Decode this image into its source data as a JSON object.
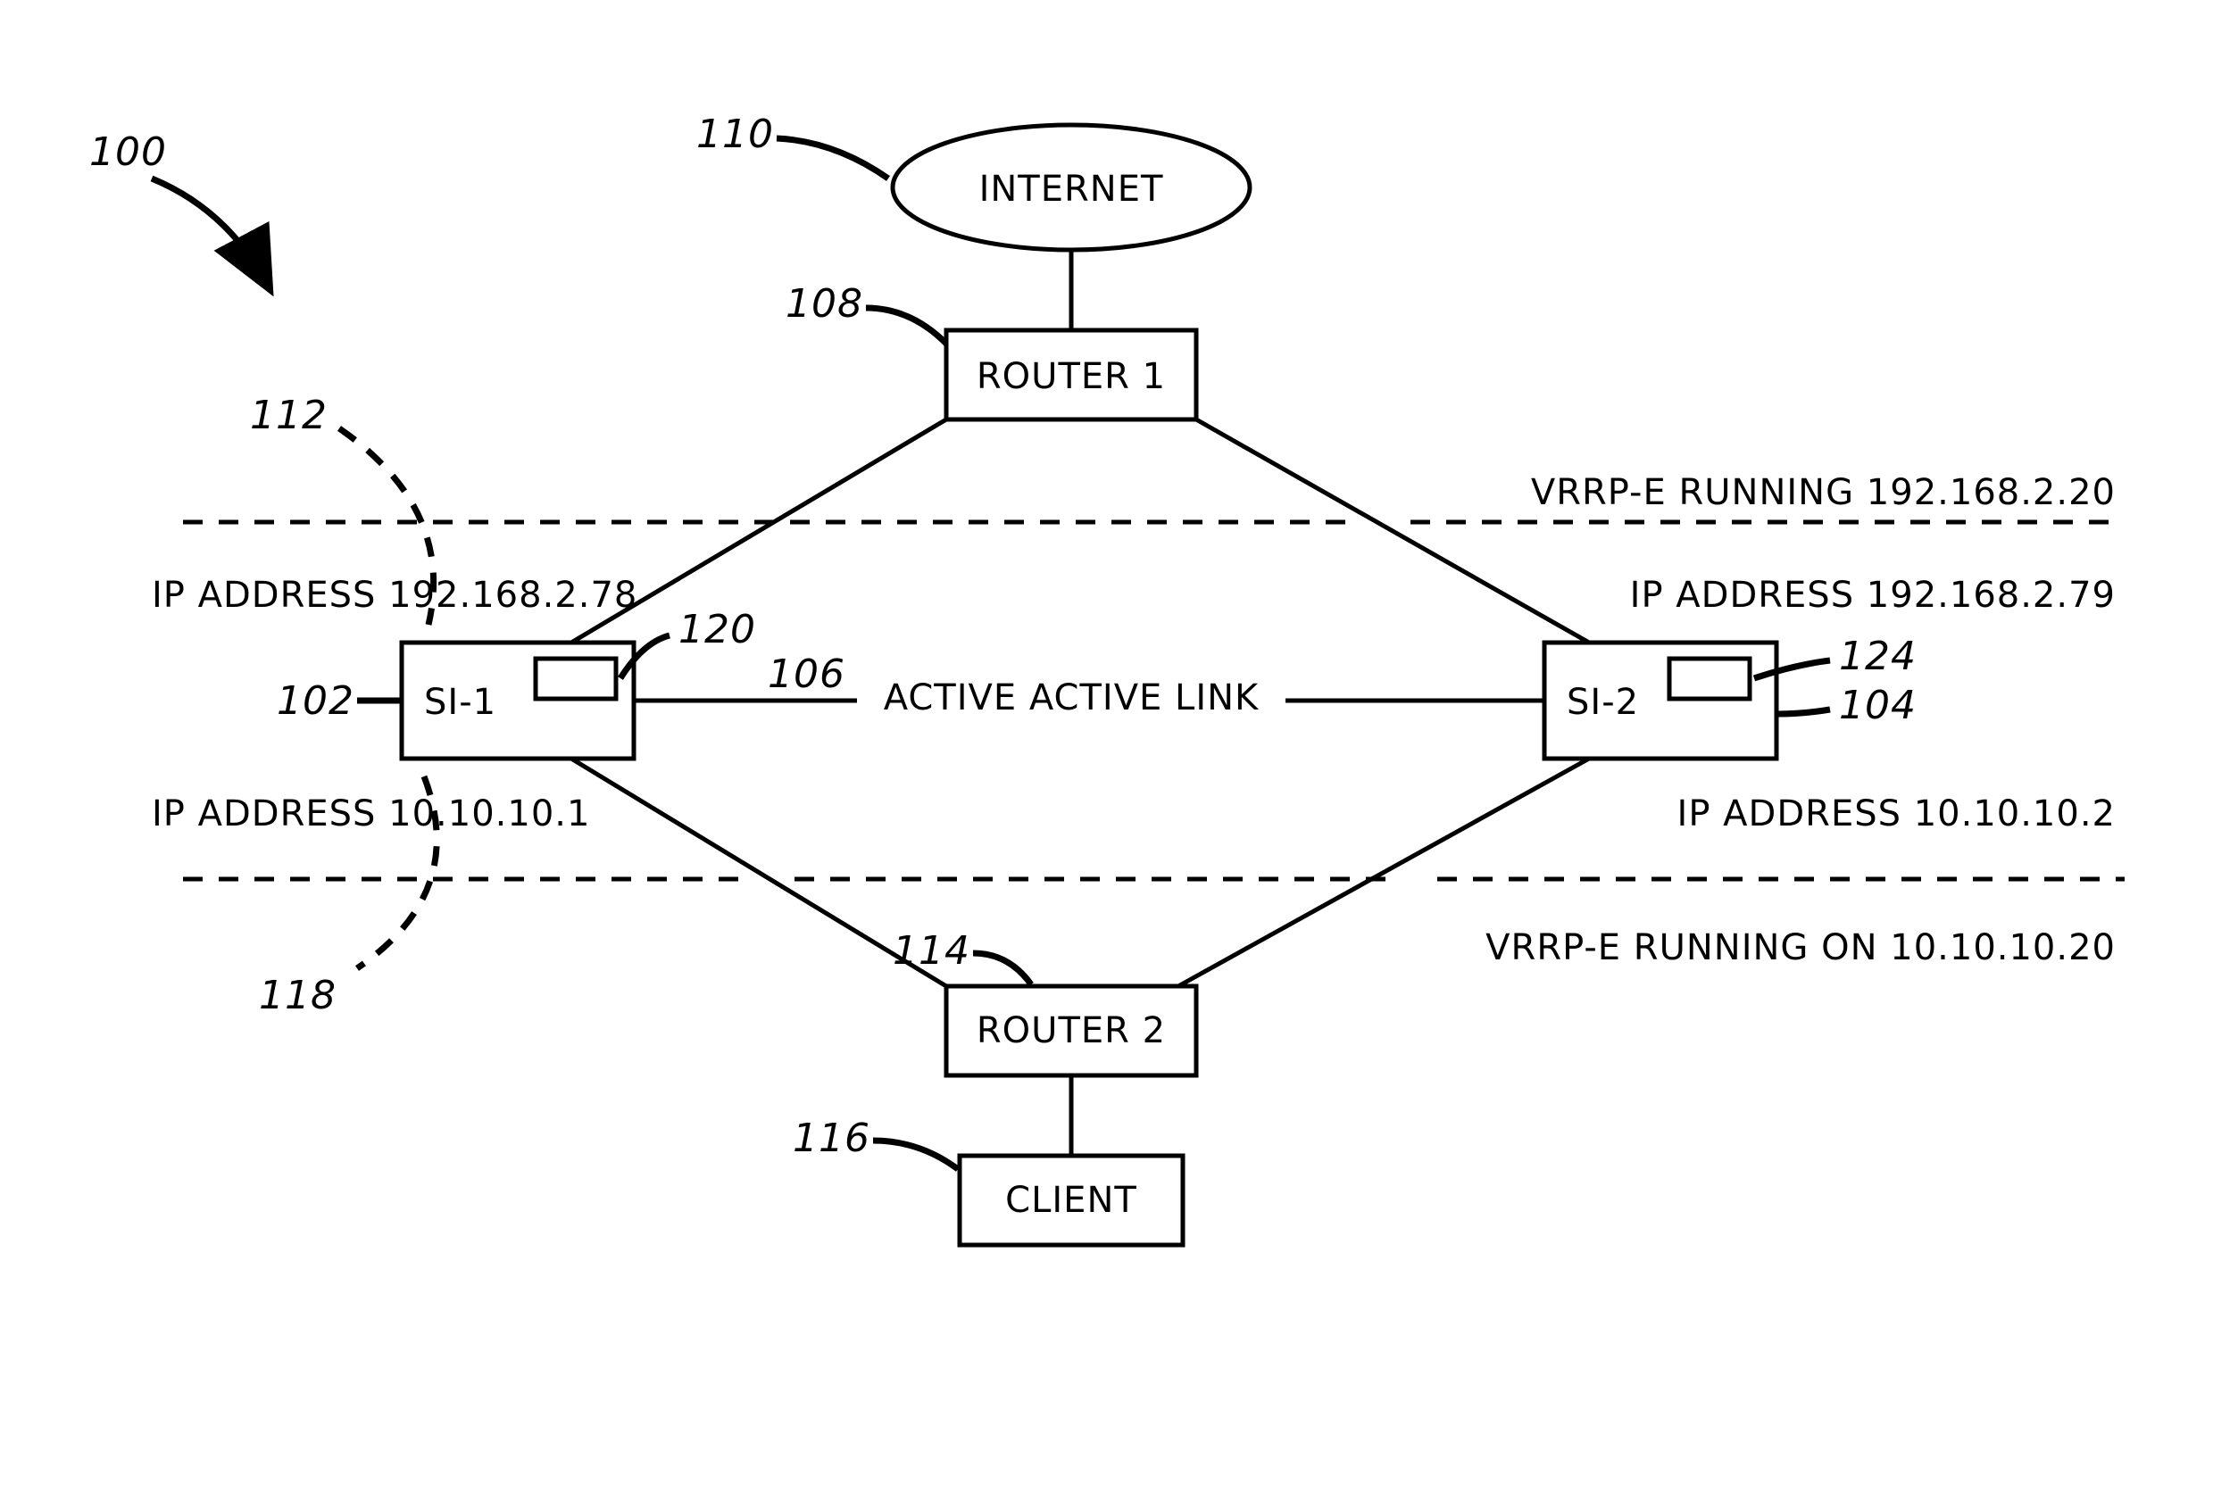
{
  "chart_data": {
    "type": "diagram",
    "title": "High-Availability Network Diagram 100",
    "nodes": [
      {
        "id": "internet",
        "ref": "110",
        "label": "INTERNET",
        "shape": "ellipse"
      },
      {
        "id": "router1",
        "ref": "108",
        "label": "ROUTER 1",
        "shape": "rect"
      },
      {
        "id": "si1",
        "ref": "102",
        "label": "SI-1",
        "shape": "rect",
        "ip_top": "IP ADDRESS 192.168.2.78",
        "ip_bottom": "IP ADDRESS 10.10.10.1",
        "inner_rect_ref": "120"
      },
      {
        "id": "si2",
        "ref": "104",
        "label": "SI-2",
        "shape": "rect",
        "ip_top": "IP ADDRESS 192.168.2.79",
        "ip_bottom": "IP ADDRESS 10.10.10.2",
        "inner_rect_ref": "124"
      },
      {
        "id": "router2",
        "ref": "114",
        "label": "ROUTER 2",
        "shape": "rect"
      },
      {
        "id": "client",
        "ref": "116",
        "label": "CLIENT",
        "shape": "rect"
      }
    ],
    "edges": [
      {
        "from": "internet",
        "to": "router1",
        "style": "solid"
      },
      {
        "from": "router1",
        "to": "si1",
        "style": "solid"
      },
      {
        "from": "router1",
        "to": "si2",
        "style": "solid"
      },
      {
        "from": "si1",
        "to": "si2",
        "style": "solid",
        "label": "ACTIVE ACTIVE LINK",
        "ref": "106"
      },
      {
        "from": "si1",
        "to": "router2",
        "style": "solid"
      },
      {
        "from": "si2",
        "to": "router2",
        "style": "solid"
      },
      {
        "from": "router2",
        "to": "client",
        "style": "solid"
      }
    ],
    "regions": [
      {
        "ref": "112",
        "label": "VRRP-E RUNNING 192.168.2.20",
        "position": "upper"
      },
      {
        "ref": "118",
        "label": "VRRP-E RUNNING ON 10.10.10.20",
        "position": "lower"
      }
    ],
    "figure_ref": "100"
  },
  "labels": {
    "fig_ref": "100",
    "internet": "INTERNET",
    "internet_ref": "110",
    "router1": "ROUTER 1",
    "router1_ref": "108",
    "si1": "SI-1",
    "si1_ref": "102",
    "si1_inner_ref": "120",
    "si1_ip_top": "IP ADDRESS 192.168.2.78",
    "si1_ip_bottom": "IP ADDRESS 10.10.10.1",
    "si2": "SI-2",
    "si2_ref": "104",
    "si2_inner_ref": "124",
    "si2_ip_top": "IP ADDRESS 192.168.2.79",
    "si2_ip_bottom": "IP ADDRESS 10.10.10.2",
    "router2": "ROUTER 2",
    "router2_ref": "114",
    "client": "CLIENT",
    "client_ref": "116",
    "link_label": "ACTIVE ACTIVE LINK",
    "link_ref": "106",
    "upper_region_ref": "112",
    "upper_region_label": "VRRP-E RUNNING 192.168.2.20",
    "lower_region_ref": "118",
    "lower_region_label": "VRRP-E RUNNING ON 10.10.10.20"
  }
}
